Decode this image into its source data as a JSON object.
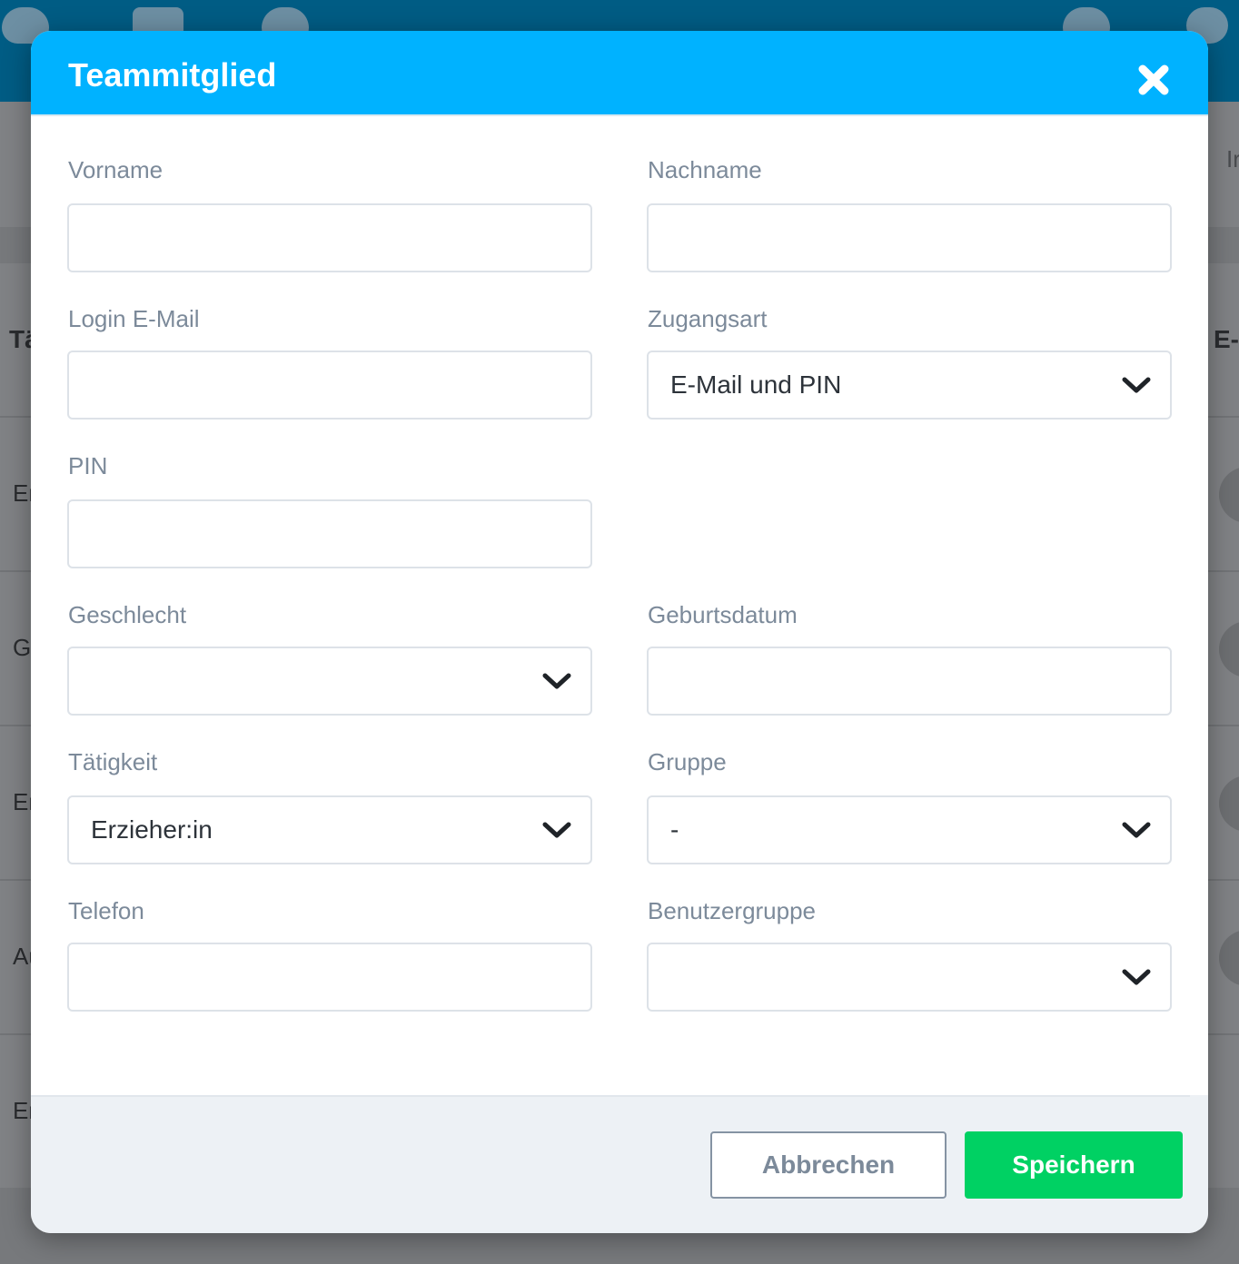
{
  "background": {
    "partial_texts": [
      "Tä",
      "E-",
      "Er",
      "G",
      "Er",
      "Au",
      "Er",
      "Ir"
    ]
  },
  "modal": {
    "title": "Teammitglied",
    "close_icon": "close-icon",
    "fields": {
      "vorname": {
        "label": "Vorname",
        "value": ""
      },
      "nachname": {
        "label": "Nachname",
        "value": ""
      },
      "login_email": {
        "label": "Login E-Mail",
        "value": ""
      },
      "zugangsart": {
        "label": "Zugangsart",
        "value": "E-Mail und PIN"
      },
      "pin": {
        "label": "PIN",
        "value": ""
      },
      "geschlecht": {
        "label": "Geschlecht",
        "value": ""
      },
      "geburtsdatum": {
        "label": "Geburtsdatum",
        "value": ""
      },
      "taetigkeit": {
        "label": "Tätigkeit",
        "value": "Erzieher:in"
      },
      "gruppe": {
        "label": "Gruppe",
        "value": "-"
      },
      "telefon": {
        "label": "Telefon",
        "value": ""
      },
      "benutzergruppe": {
        "label": "Benutzergruppe",
        "value": ""
      }
    },
    "buttons": {
      "cancel_label": "Abbrechen",
      "save_label": "Speichern"
    }
  },
  "colors": {
    "header": "#00b2ff",
    "save_button": "#00d163",
    "topbar": "#005c84",
    "label": "#7c8a9a"
  }
}
